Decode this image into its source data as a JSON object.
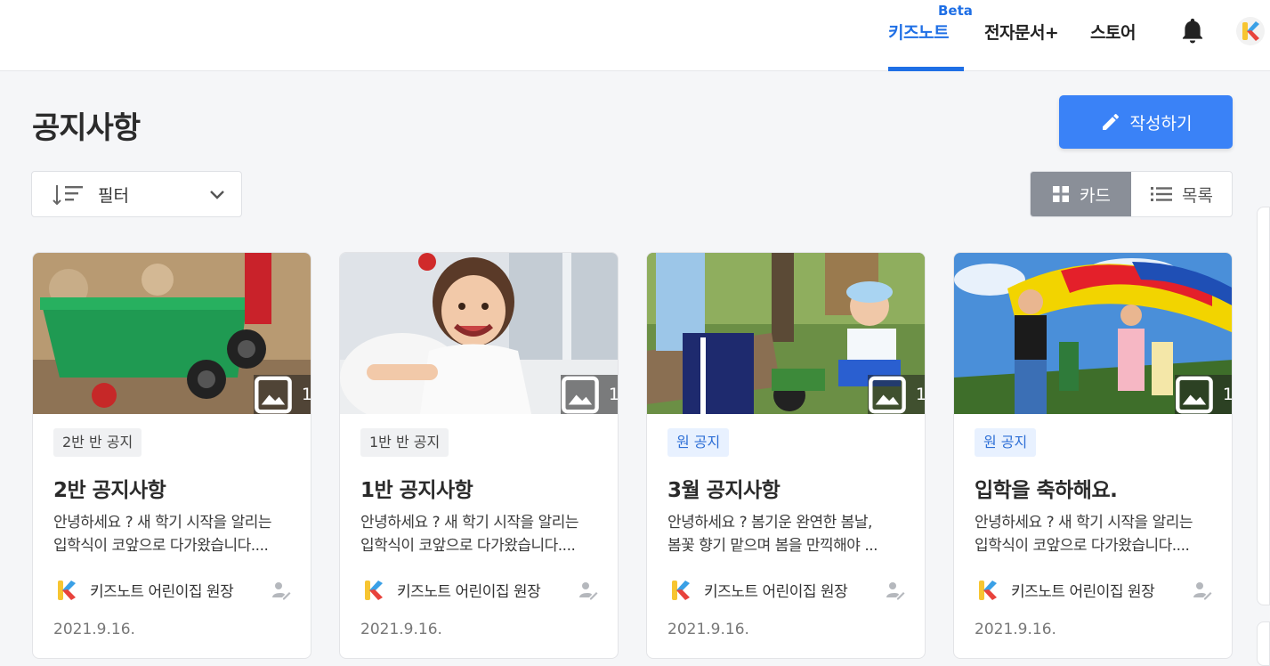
{
  "nav": {
    "beta": "Beta",
    "items": [
      {
        "label": "키즈노트",
        "active": true
      },
      {
        "label": "전자문서+"
      },
      {
        "label": "스토어"
      }
    ],
    "accent": "#1f6fe5"
  },
  "header": {
    "title": "공지사항",
    "write_label": "작성하기"
  },
  "filter": {
    "label": "필터"
  },
  "view": {
    "card_label": "카드",
    "list_label": "목록",
    "selected": "카드"
  },
  "cards": [
    {
      "image_count": "1",
      "tag": "2반 반 공지",
      "tag_style": "gray",
      "title": "2반 공지사항",
      "body_line1": "안녕하세요 ? 새 학기 시작을 알리는",
      "body_line2": "입학식이 코앞으로 다가왔습니다....",
      "author": "키즈노트 어린이집 원장",
      "date": "2021.9.16."
    },
    {
      "image_count": "1",
      "tag": "1반 반 공지",
      "tag_style": "gray",
      "title": "1반 공지사항",
      "body_line1": "안녕하세요 ? 새 학기 시작을 알리는",
      "body_line2": "입학식이 코앞으로 다가왔습니다....",
      "author": "키즈노트 어린이집 원장",
      "date": "2021.9.16."
    },
    {
      "image_count": "1",
      "tag": "원 공지",
      "tag_style": "blue",
      "title": "3월 공지사항",
      "body_line1": "안녕하세요 ? 봄기운 완연한 봄날,",
      "body_line2": "봄꽃 향기 맡으며 봄을 만끽해야 ...",
      "author": "키즈노트 어린이집 원장",
      "date": "2021.9.16."
    },
    {
      "image_count": "1",
      "tag": "원 공지",
      "tag_style": "blue",
      "title": "입학을 축하해요.",
      "body_line1": "안녕하세요 ? 새 학기 시작을 알리는",
      "body_line2": "입학식이 코앞으로 다가왔습니다....",
      "author": "키즈노트 어린이집 원장",
      "date": "2021.9.16."
    }
  ]
}
